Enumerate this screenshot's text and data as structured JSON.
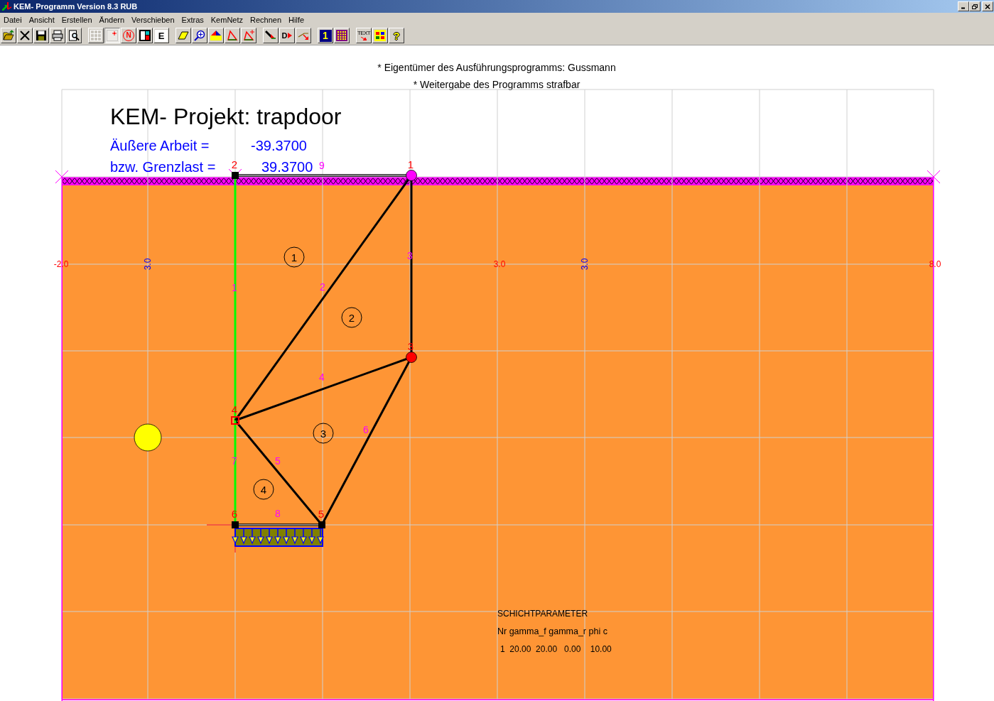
{
  "window": {
    "title": "KEM- Programm Version 8.3 RUB"
  },
  "menu": [
    "Datei",
    "Ansicht",
    "Erstellen",
    "Ändern",
    "Verschieben",
    "Extras",
    "KemNetz",
    "Rechnen",
    "Hilfe"
  ],
  "toolbar": [
    [
      {
        "kind": "open",
        "pressed": false
      },
      {
        "kind": "close",
        "pressed": false
      },
      {
        "kind": "save",
        "pressed": false
      },
      {
        "kind": "print",
        "pressed": false
      },
      {
        "kind": "preview",
        "pressed": false
      }
    ],
    [
      {
        "kind": "grid",
        "pressed": false
      },
      {
        "kind": "point",
        "pressed": true
      },
      {
        "kind": "stop",
        "label": "N",
        "pressed": false
      },
      {
        "kind": "split",
        "pressed": false
      },
      {
        "kind": "letter",
        "label": "E",
        "pressed": false
      }
    ],
    [
      {
        "kind": "parallelogram",
        "pressed": false
      },
      {
        "kind": "zoom",
        "pressed": false
      },
      {
        "kind": "fill",
        "pressed": false
      },
      {
        "kind": "triangle",
        "pressed": false
      },
      {
        "kind": "triangle-point",
        "pressed": false
      }
    ],
    [
      {
        "kind": "arrow",
        "pressed": false
      },
      {
        "kind": "letter-arrow",
        "label": "D",
        "pressed": false
      },
      {
        "kind": "line-arrow",
        "pressed": false
      }
    ],
    [
      {
        "kind": "number",
        "label": "1",
        "pressed": false
      },
      {
        "kind": "dots",
        "pressed": false
      }
    ],
    [
      {
        "kind": "text",
        "label": "TEXT",
        "pressed": false
      },
      {
        "kind": "squares",
        "pressed": false
      },
      {
        "kind": "help",
        "label": "?",
        "pressed": false
      }
    ]
  ],
  "canvas": {
    "notices": [
      "* Eigentümer des Ausführungsprogramms: Gussmann",
      "* Weitergabe des Programms strafbar"
    ],
    "project_title": "KEM- Projekt: trapdoor",
    "results": [
      {
        "label": "Äußere Arbeit =",
        "value": "-39.3700"
      },
      {
        "label": "bzw. Grenzlast =",
        "value": "39.3700"
      }
    ],
    "axis_labels": [
      {
        "text": "-2.0",
        "kind": "x"
      },
      {
        "text": "3.0",
        "kind": "y"
      },
      {
        "text": "3.0",
        "kind": "x"
      },
      {
        "text": "3.0",
        "kind": "y"
      },
      {
        "text": "8.0",
        "kind": "x"
      }
    ],
    "nodes": [
      {
        "label": "1",
        "kind": "circle",
        "color": "#ff00ff"
      },
      {
        "label": "2",
        "kind": "square",
        "color": "#000000"
      },
      {
        "label": "3",
        "kind": "circle",
        "color": "#ff0000"
      },
      {
        "label": "4",
        "kind": "hollow",
        "color": "#ff0000"
      },
      {
        "label": "5",
        "kind": "square",
        "color": "#000000"
      },
      {
        "label": "6",
        "kind": "square",
        "color": "#000000"
      }
    ],
    "edges": [
      {
        "label": "1",
        "kind": "thick",
        "color": "#00ff00"
      },
      {
        "label": "2",
        "kind": "thick",
        "color": "#000000"
      },
      {
        "label": "3",
        "kind": "thick",
        "color": "#000000"
      },
      {
        "label": "4",
        "kind": "thick",
        "color": "#000000"
      },
      {
        "label": "5",
        "kind": "thick",
        "color": "#000000"
      },
      {
        "label": "6",
        "kind": "thick",
        "color": "#000000"
      },
      {
        "label": "7",
        "kind": "thick",
        "color": "#00ff00"
      },
      {
        "label": "8",
        "kind": "double"
      },
      {
        "label": "9",
        "kind": "double"
      }
    ],
    "elements": [
      "1",
      "2",
      "3",
      "4"
    ],
    "layer_parameters": {
      "title": "SCHICHTPARAMETER",
      "header": "Nr gamma_f gamma_r phi c",
      "rows": [
        "1  20.00  20.00   0.00    10.00"
      ]
    }
  }
}
